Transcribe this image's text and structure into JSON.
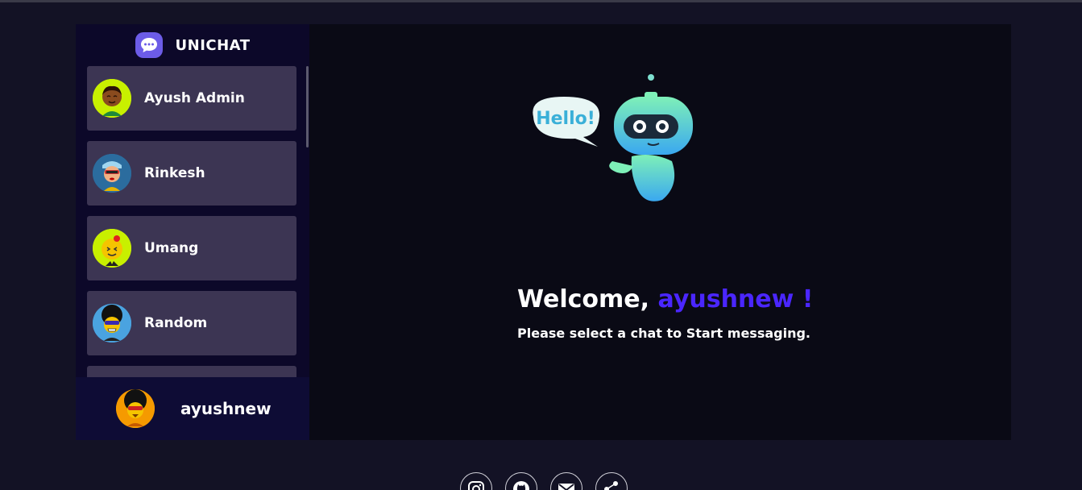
{
  "brand": {
    "title": "UNICHAT"
  },
  "sidebar": {
    "items": [
      {
        "label": "Ayush Admin"
      },
      {
        "label": "Rinkesh"
      },
      {
        "label": "Umang"
      },
      {
        "label": "Random"
      }
    ]
  },
  "profile": {
    "name": "ayushnew"
  },
  "main": {
    "bubble_text": "Hello!",
    "welcome_prefix": "Welcome, ",
    "welcome_user": "ayushnew !",
    "subtitle": "Please select a chat to Start messaging."
  },
  "footer": {
    "icons": [
      "instagram-icon",
      "github-icon",
      "mail-icon",
      "share-icon"
    ]
  },
  "colors": {
    "accent": "#4a26ff",
    "item_bg": "#3c3553",
    "sidebar_bg": "#0c0829"
  }
}
